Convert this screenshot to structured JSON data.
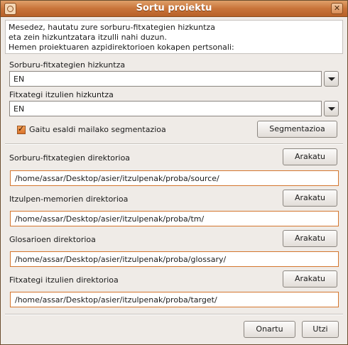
{
  "window": {
    "title": "Sortu proiektu",
    "close_icon": "close-icon",
    "app_icon": "app-icon"
  },
  "intro": {
    "line1": "Mesedez, hautatu zure sorburu-fitxategien hizkuntza",
    "line2": "eta zein hizkuntzatara itzulli nahi duzun.",
    "line3": "Hemen proiektuaren azpidirektorioen kokapen pertsonali:"
  },
  "source_lang": {
    "label": "Sorburu-fitxategien hizkuntza",
    "value": "EN"
  },
  "target_lang": {
    "label": "Fitxategi itzulien hizkuntza",
    "value": "EN"
  },
  "segmentation": {
    "checkbox_label": "Gaitu esaldi mailako segmentazioa",
    "checked": true,
    "button_label": "Segmentazioa"
  },
  "directories": [
    {
      "label": "Sorburu-fitxategien direktorioa",
      "button": "Arakatu",
      "value": "/home/assar/Desktop/asier/itzulpenak/proba/source/"
    },
    {
      "label": "Itzulpen-memorien direktorioa",
      "button": "Arakatu",
      "value": "/home/assar/Desktop/asier/itzulpenak/proba/tm/"
    },
    {
      "label": "Glosarioen direktorioa",
      "button": "Arakatu",
      "value": "/home/assar/Desktop/asier/itzulpenak/proba/glossary/"
    },
    {
      "label": "Fitxategi itzulien direktorioa",
      "button": "Arakatu",
      "value": "/home/assar/Desktop/asier/itzulpenak/proba/target/"
    }
  ],
  "footer": {
    "ok_label": "Onartu",
    "cancel_label": "Utzi"
  },
  "colors": {
    "titlebar": "#c8743a",
    "accent": "#d4762e",
    "background": "#efebe7"
  }
}
